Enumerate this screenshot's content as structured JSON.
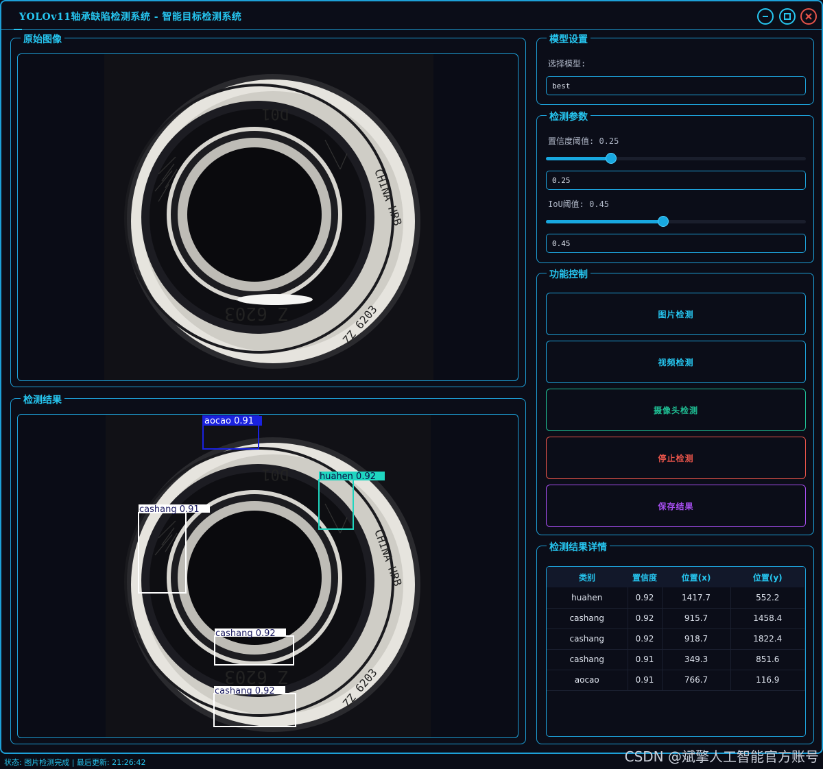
{
  "window": {
    "title": "YOLOv11轴承缺陷检测系统 - 智能目标检测系统"
  },
  "panels": {
    "original_image_title": "原始图像",
    "result_image_title": "检测结果",
    "model_title": "模型设置",
    "params_title": "检测参数",
    "control_title": "功能控制",
    "details_title": "检测结果详情"
  },
  "model": {
    "select_label": "选择模型:",
    "selected_value": "best"
  },
  "params": {
    "confidence_label": "置信度阈值: 0.25",
    "confidence_value": "0.25",
    "confidence_level": 0.25,
    "iou_label": "IoU阈值: 0.45",
    "iou_value": "0.45",
    "iou_level": 0.45
  },
  "controls": {
    "image_detect": "图片检测",
    "video_detect": "视频检测",
    "camera_detect": "摄像头检测",
    "stop_detect": "停止检测",
    "save_results": "保存结果"
  },
  "image_text": {
    "top_marking": "D01",
    "side_marking": "CHINA HRB",
    "bottom_marking": "Z 6203",
    "rim_marking": "ZZ 6203"
  },
  "detections": [
    {
      "label": "aocao 0.91",
      "color": "#1a22e0"
    },
    {
      "label": "huahen 0.92",
      "color": "#1fd6c0"
    },
    {
      "label": "cashang 0.91",
      "color": "#ffffff"
    },
    {
      "label": "cashang 0.92",
      "color": "#ffffff"
    },
    {
      "label": "cashang 0.92",
      "color": "#ffffff"
    }
  ],
  "table": {
    "headers": [
      "类别",
      "置信度",
      "位置(x)",
      "位置(y)"
    ],
    "rows": [
      [
        "huahen",
        "0.92",
        "1417.7",
        "552.2"
      ],
      [
        "cashang",
        "0.92",
        "915.7",
        "1458.4"
      ],
      [
        "cashang",
        "0.92",
        "918.7",
        "1822.4"
      ],
      [
        "cashang",
        "0.91",
        "349.3",
        "851.6"
      ],
      [
        "aocao",
        "0.91",
        "766.7",
        "116.9"
      ]
    ]
  },
  "status": {
    "text": "状态: 图片检测完成 | 最后更新: 21:26:42"
  },
  "watermark": "CSDN @斌擎人工智能官方账号",
  "colors": {
    "accent": "#26c6f0",
    "border": "#1da0d8",
    "background": "#0b0d18",
    "camera_button": "#1fbf94",
    "stop_button": "#e8544a",
    "save_button": "#a64ef0"
  }
}
